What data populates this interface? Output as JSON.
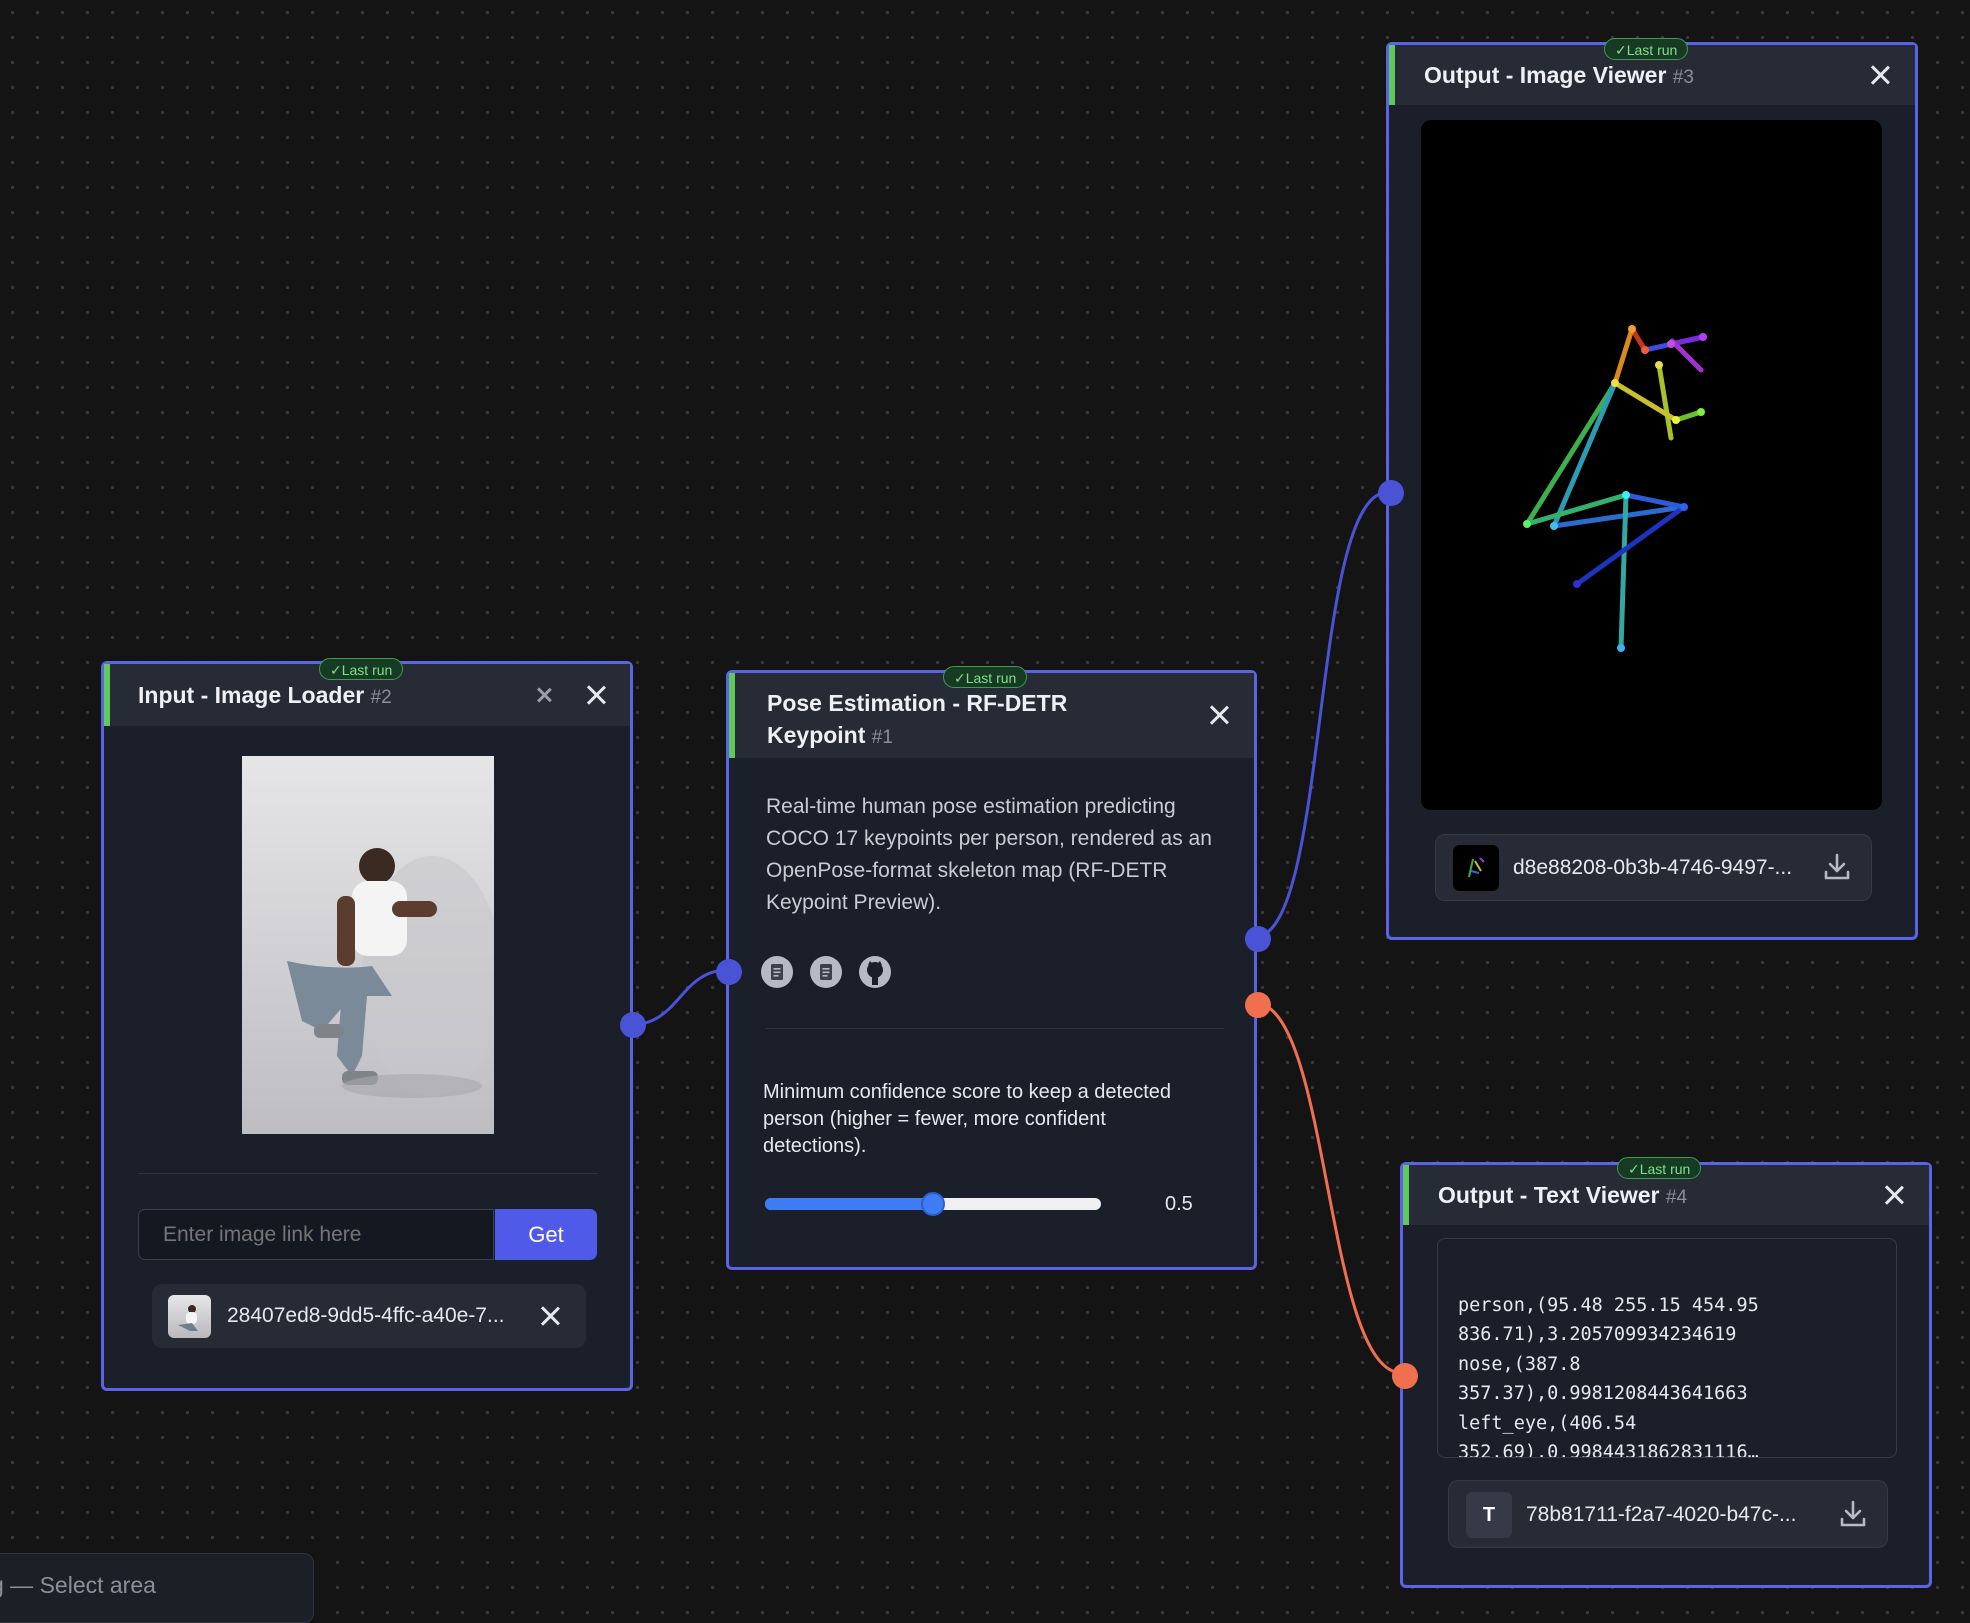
{
  "colors": {
    "accent": "#5b63e6",
    "port_blue": "#4a52d6",
    "port_orange": "#f06f4f",
    "run_green": "#5fc95a"
  },
  "canvas": {
    "status_hint": "g — Select area"
  },
  "nodes": {
    "image_loader": {
      "title": "Input - Image Loader",
      "id": "#2",
      "badge": "✓Last run",
      "url_placeholder": "Enter image link here",
      "get_label": "Get",
      "file_name": "28407ed8-9dd5-4ffc-a40e-7..."
    },
    "pose": {
      "title_line1": "Pose Estimation - RF-DETR",
      "title_line2": "Keypoint",
      "id": "#1",
      "badge": "✓Last run",
      "description": "Real-time human pose estimation predicting COCO 17 keypoints per person, rendered as an OpenPose-format skeleton map (RF-DETR Keypoint Preview).",
      "icons": [
        "doc-icon",
        "doc-icon",
        "github-icon"
      ],
      "slider_label": "Minimum confidence score to keep a detected person (higher = fewer, more confident detections).",
      "slider_value": "0.5",
      "slider_fraction": 0.5
    },
    "image_viewer": {
      "title": "Output - Image Viewer",
      "id": "#3",
      "badge": "✓Last run",
      "file_name": "d8e88208-0b3b-4746-9497-..."
    },
    "text_viewer": {
      "title": "Output - Text Viewer",
      "id": "#4",
      "badge": "✓Last run",
      "lines": [
        "person,(95.48 255.15 454.95",
        "836.71),3.205709934234619",
        "nose,(387.8",
        "357.37),0.9981208443641663",
        "left_eye,(406.54",
        "352.69),0.9984431862831116…"
      ],
      "file_type": "T",
      "file_name": "78b81711-f2a7-4020-b47c-..."
    }
  }
}
